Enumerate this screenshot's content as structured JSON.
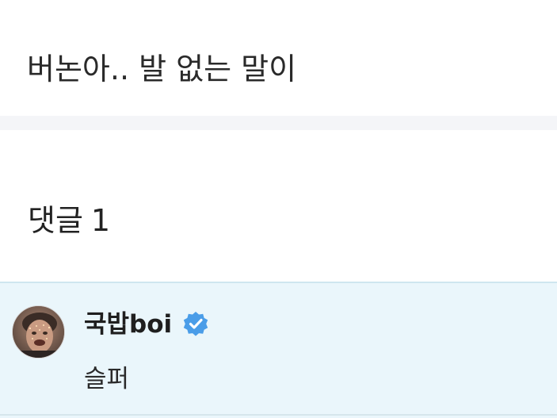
{
  "post": {
    "text": "버논아.. 발 없는 말이"
  },
  "comments": {
    "label": "댓글",
    "count": "1",
    "items": [
      {
        "author": "국밥boi",
        "verified": true,
        "text": "슬퍼",
        "avatar_icon": "avatar-photo"
      }
    ]
  },
  "colors": {
    "comment_background": "#eaf6fb",
    "divider_band": "#f4f5f8",
    "verified_badge": "#4a9de8"
  }
}
